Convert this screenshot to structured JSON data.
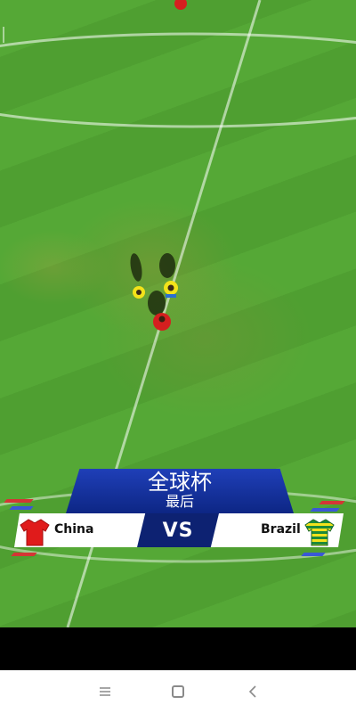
{
  "match": {
    "tournament_title": "全球杯",
    "round_label": "最后",
    "vs_label": "VS",
    "home_team": {
      "name": "China",
      "jersey_colors": [
        "#e01b1b"
      ]
    },
    "away_team": {
      "name": "Brazil",
      "jersey_colors": [
        "#f2e21c",
        "#1d8a3a"
      ]
    }
  },
  "colors": {
    "banner_blue": "#1f3fb8",
    "banner_dark": "#0d2272",
    "pitch_green": "#55a836"
  },
  "navigation": {
    "menu_icon": "menu-icon",
    "home_icon": "home-icon",
    "back_icon": "back-icon"
  }
}
